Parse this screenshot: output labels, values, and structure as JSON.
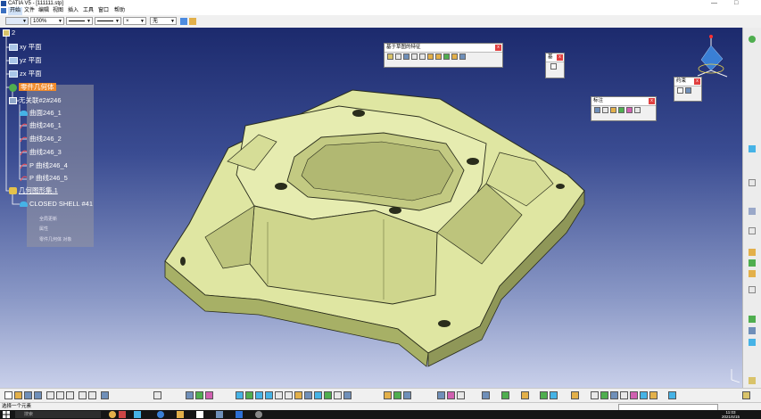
{
  "window": {
    "title": "CATIA V5 - [111111.stp]",
    "controls": [
      "—",
      "□"
    ]
  },
  "menu": [
    "开始",
    "文件",
    "编辑",
    "视图",
    "插入",
    "工具",
    "窗口",
    "帮助"
  ],
  "properties_bar": {
    "zoom": "100%",
    "layer": "无"
  },
  "tree": {
    "root": "2",
    "nodes": [
      {
        "label": "xy 平面",
        "icon": "plane-icon"
      },
      {
        "label": "yz 平面",
        "icon": "plane-icon"
      },
      {
        "label": "zx 平面",
        "icon": "plane-icon"
      },
      {
        "label": "零件几何体",
        "icon": "gear-icon",
        "selected": true
      },
      {
        "label": "无关联#2#246",
        "icon": "body-icon"
      },
      {
        "label": "曲面246_1",
        "icon": "surface-icon"
      },
      {
        "label": "曲线246_1",
        "icon": "curve-icon"
      },
      {
        "label": "曲线246_2",
        "icon": "curve-icon"
      },
      {
        "label": "曲线246_3",
        "icon": "curve-icon"
      },
      {
        "label": "P 曲线246_4",
        "icon": "curve-icon"
      },
      {
        "label": "P 曲线246_5",
        "icon": "curve-icon"
      },
      {
        "label": "几何图形集.1",
        "icon": "geometric-set-icon"
      },
      {
        "label": "CLOSED SHELL #41",
        "icon": "surface-icon"
      }
    ]
  },
  "context_menu": {
    "items": [
      "全局更新",
      "属性",
      "零件几何体 对象"
    ]
  },
  "toolbars": {
    "measure_toolbar": {
      "title": "基于草图的特征",
      "close": "x"
    },
    "small_toolbar": {
      "title": "基",
      "close": "x"
    },
    "annotation_toolbar": {
      "title": "标注",
      "close": "x"
    },
    "small_toolbar2": {
      "title": "约束",
      "close": "x"
    }
  },
  "status": {
    "text": "选择一个元素"
  },
  "taskbar": {
    "search_placeholder": "搜索",
    "time": "11:03",
    "date": "2021/6/15"
  },
  "colors": {
    "part_face": "#dfe6a2",
    "part_shadow": "#a7b066",
    "part_edge": "#2a2d1c",
    "viewport_top": "#1c2a6d",
    "viewport_bottom": "#c9d0ea",
    "compass_blue": "#3a7fd5"
  }
}
